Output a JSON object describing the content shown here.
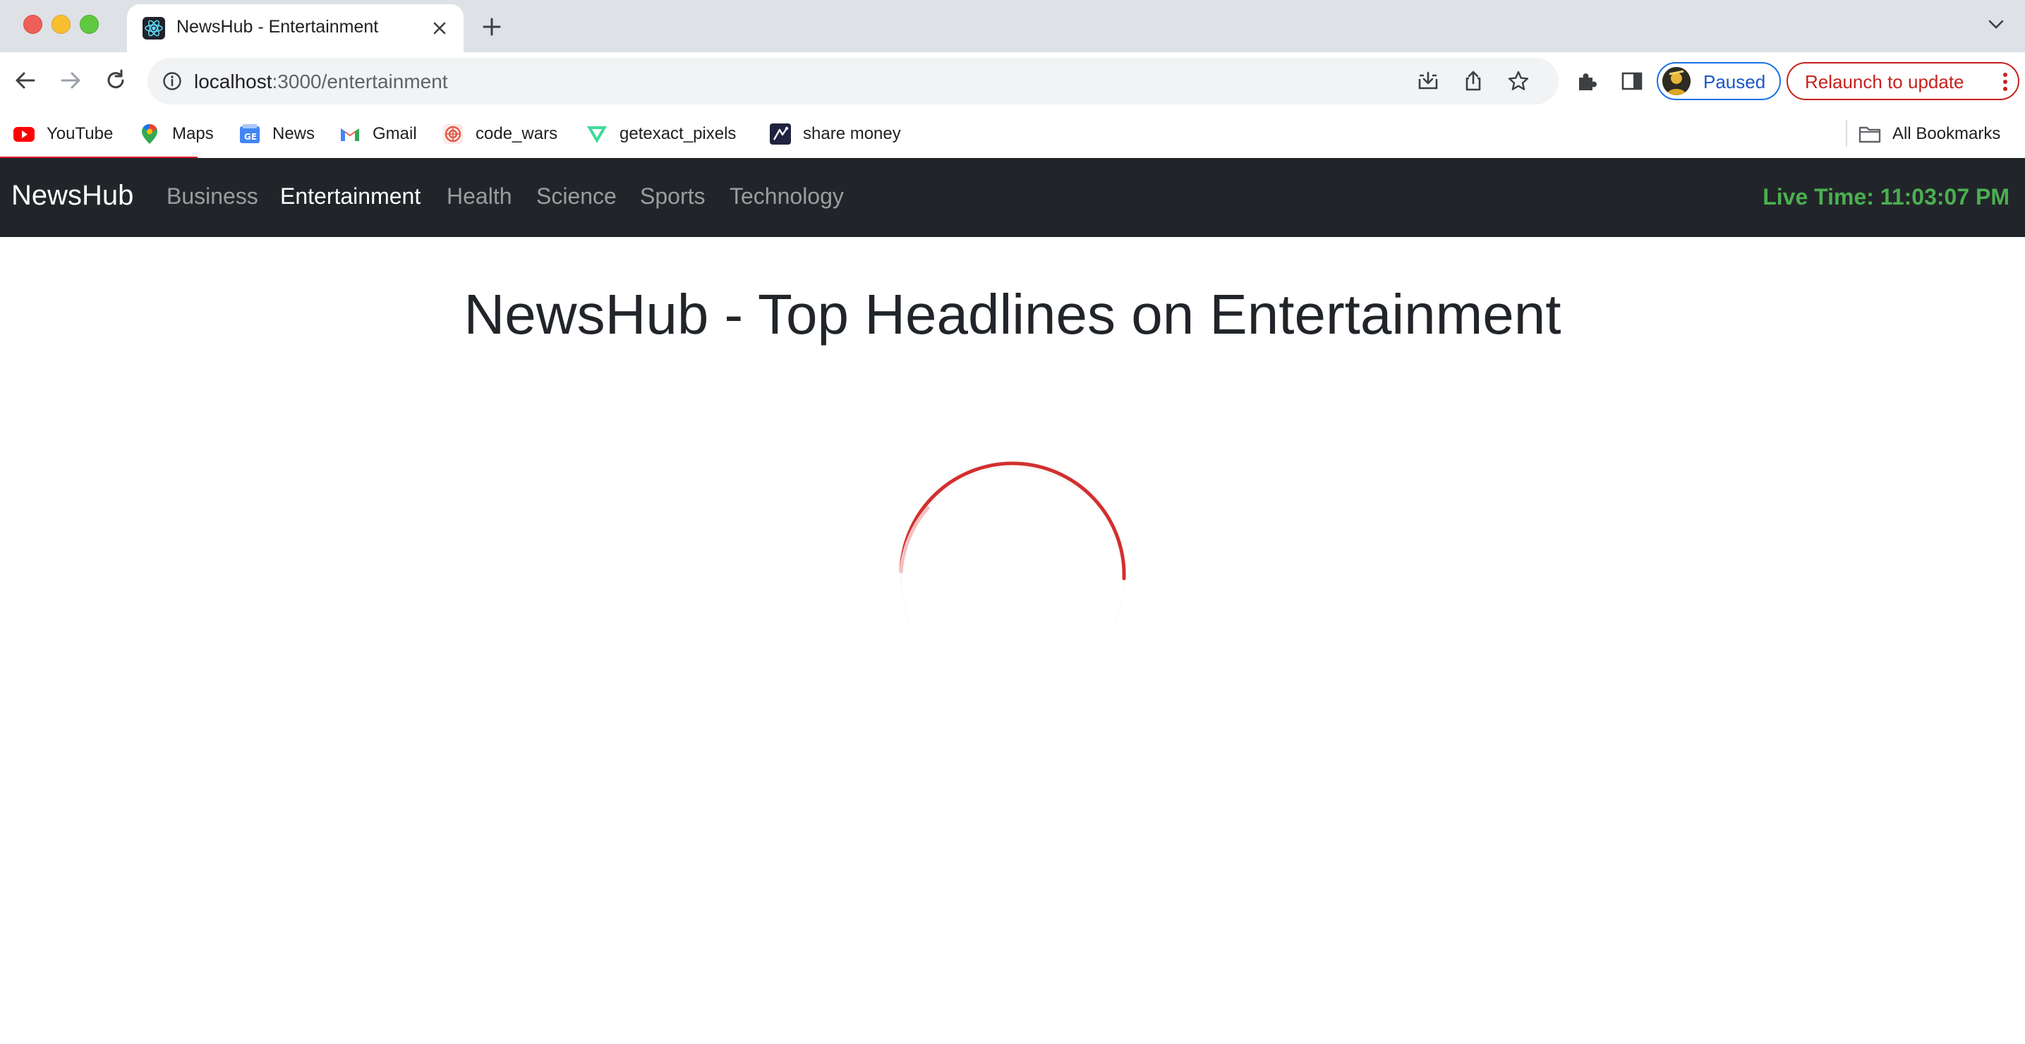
{
  "browser": {
    "tab": {
      "title": "NewsHub - Entertainment",
      "favicon": "react-atom-icon"
    },
    "address": {
      "host": "localhost",
      "path": ":3000/entertainment"
    },
    "profile": {
      "label": "Paused"
    },
    "relaunch": {
      "label": "Relaunch to update"
    },
    "bookmarks": [
      {
        "label": "YouTube",
        "icon": "youtube-icon"
      },
      {
        "label": "Maps",
        "icon": "maps-icon"
      },
      {
        "label": "News",
        "icon": "google-news-icon"
      },
      {
        "label": "Gmail",
        "icon": "gmail-icon"
      },
      {
        "label": "code_wars",
        "icon": "codewars-icon"
      },
      {
        "label": "getexact_pixels",
        "icon": "getexact-pixels-icon"
      },
      {
        "label": "share money",
        "icon": "share-money-icon"
      }
    ],
    "all_bookmarks": "All Bookmarks"
  },
  "navbar": {
    "brand": "NewsHub",
    "links": [
      {
        "label": "Business",
        "active": false
      },
      {
        "label": "Entertainment",
        "active": true
      },
      {
        "label": "Health",
        "active": false
      },
      {
        "label": "Science",
        "active": false
      },
      {
        "label": "Sports",
        "active": false
      },
      {
        "label": "Technology",
        "active": false
      }
    ],
    "live_time": "Live Time: 11:03:07 PM"
  },
  "main": {
    "title": "NewsHub - Top Headlines on Entertainment"
  },
  "colors": {
    "navbar_bg": "#212529",
    "live_time": "#4caf50",
    "spinner": "#d32f2f",
    "relaunch": "#c5221f",
    "profile_accent": "#1a73e8"
  }
}
